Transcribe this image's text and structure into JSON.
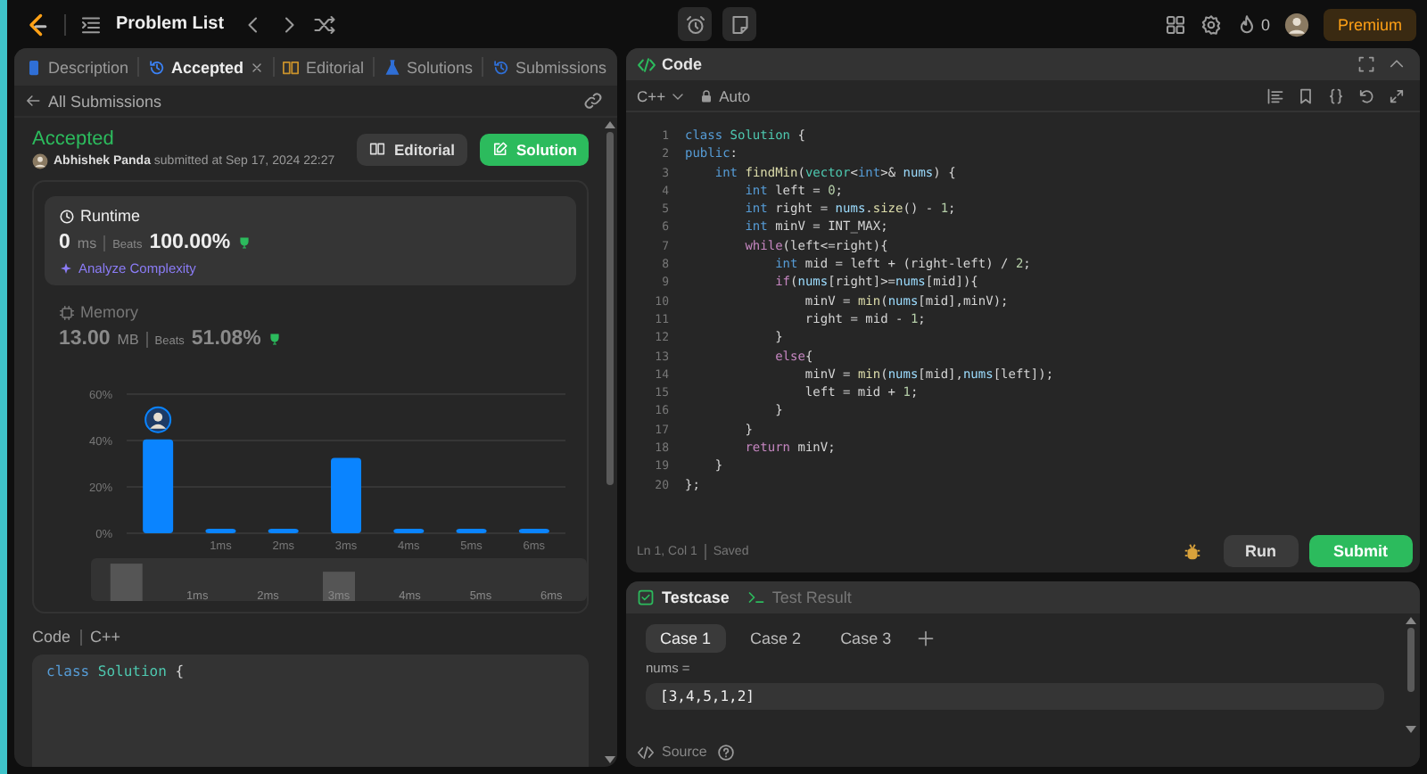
{
  "topbar": {
    "title": "Problem List",
    "fire_count": "0",
    "premium": "Premium"
  },
  "left_panel": {
    "tabs": [
      {
        "label": "Description",
        "selected": false,
        "closable": false
      },
      {
        "label": "Accepted",
        "selected": true,
        "closable": true
      },
      {
        "label": "Editorial",
        "selected": false,
        "closable": false
      },
      {
        "label": "Solutions",
        "selected": false,
        "closable": false
      },
      {
        "label": "Submissions",
        "selected": false,
        "closable": false
      }
    ],
    "back_link": "All Submissions",
    "result": {
      "status": "Accepted",
      "author": "Abhishek Panda",
      "submitted_text": "submitted at Sep 17, 2024 22:27"
    },
    "buttons": [
      {
        "label": "Editorial",
        "kind": "secondary"
      },
      {
        "label": "Solution",
        "kind": "primary"
      }
    ],
    "stats": [
      {
        "title": "Runtime",
        "value": "0",
        "unit": "ms",
        "beats_label": "Beats",
        "beats": "100.00%",
        "selected": true,
        "link": "Analyze Complexity"
      },
      {
        "title": "Memory",
        "value": "13.00",
        "unit": "MB",
        "beats_label": "Beats",
        "beats": "51.08%",
        "selected": false
      }
    ],
    "chart_data": {
      "type": "bar",
      "categories": [
        null,
        "1ms",
        "2ms",
        "3ms",
        "4ms",
        "5ms",
        "6ms"
      ],
      "values": [
        40.5,
        1.2,
        1.2,
        32.5,
        1.8,
        1.2,
        1.2
      ],
      "ylim": [
        0,
        60
      ],
      "yticks": [
        {
          "value": 0,
          "label": "0%"
        },
        {
          "value": 20,
          "label": "20%"
        },
        {
          "value": 40,
          "label": "40%"
        },
        {
          "value": 60,
          "label": "60%"
        }
      ]
    },
    "overview_labels": [
      "1ms",
      "2ms",
      "3ms",
      "4ms",
      "5ms",
      "6ms"
    ],
    "code_label": "Code",
    "code_language": "C++",
    "code_preview": [
      {
        "kind": "kw",
        "text": "class"
      },
      {
        "kind": "type",
        "text": " Solution"
      },
      {
        "kind": "plain",
        "text": " {"
      }
    ]
  },
  "editor": {
    "title": "Code",
    "language": "C++",
    "mode": "Auto",
    "lines": [
      {
        "number": "1",
        "tokens": [
          {
            "kind": "kw",
            "text": "class"
          },
          {
            "kind": "type",
            "text": " Solution"
          },
          {
            "kind": "plain",
            "text": " {"
          }
        ]
      },
      {
        "number": "2",
        "tokens": [
          {
            "kind": "kw",
            "text": "public"
          },
          {
            "kind": "plain",
            "text": ":"
          }
        ]
      },
      {
        "number": "3",
        "tokens": [
          {
            "kind": "kw",
            "text": "    int"
          },
          {
            "kind": "fn",
            "text": " findMin"
          },
          {
            "kind": "plain",
            "text": "("
          },
          {
            "kind": "type",
            "text": "vector"
          },
          {
            "kind": "plain",
            "text": "<"
          },
          {
            "kind": "kw",
            "text": "int"
          },
          {
            "kind": "plain",
            "text": ">& "
          },
          {
            "kind": "var",
            "text": "nums"
          },
          {
            "kind": "plain",
            "text": ") {"
          }
        ]
      },
      {
        "number": "4",
        "tokens": [
          {
            "kind": "kw",
            "text": "        int"
          },
          {
            "kind": "plain",
            "text": " left = "
          },
          {
            "kind": "num",
            "text": "0"
          },
          {
            "kind": "plain",
            "text": ";"
          }
        ]
      },
      {
        "number": "5",
        "tokens": [
          {
            "kind": "kw",
            "text": "        int"
          },
          {
            "kind": "plain",
            "text": " right = "
          },
          {
            "kind": "var",
            "text": "nums"
          },
          {
            "kind": "plain",
            "text": "."
          },
          {
            "kind": "fn",
            "text": "size"
          },
          {
            "kind": "plain",
            "text": "() - "
          },
          {
            "kind": "num",
            "text": "1"
          },
          {
            "kind": "plain",
            "text": ";"
          }
        ]
      },
      {
        "number": "6",
        "tokens": [
          {
            "kind": "kw",
            "text": "        int"
          },
          {
            "kind": "plain",
            "text": " minV = INT_MAX;"
          }
        ]
      },
      {
        "number": "7",
        "tokens": [
          {
            "kind": "ctl",
            "text": "        while"
          },
          {
            "kind": "plain",
            "text": "(left<=right){"
          }
        ]
      },
      {
        "number": "8",
        "tokens": [
          {
            "kind": "kw",
            "text": "            int"
          },
          {
            "kind": "plain",
            "text": " mid = left + (right-left) / "
          },
          {
            "kind": "num",
            "text": "2"
          },
          {
            "kind": "plain",
            "text": ";"
          }
        ]
      },
      {
        "number": "9",
        "tokens": [
          {
            "kind": "ctl",
            "text": "            if"
          },
          {
            "kind": "plain",
            "text": "("
          },
          {
            "kind": "var",
            "text": "nums"
          },
          {
            "kind": "plain",
            "text": "[right]>="
          },
          {
            "kind": "var",
            "text": "nums"
          },
          {
            "kind": "plain",
            "text": "[mid]){"
          }
        ]
      },
      {
        "number": "10",
        "tokens": [
          {
            "kind": "plain",
            "text": "                minV = "
          },
          {
            "kind": "fn",
            "text": "min"
          },
          {
            "kind": "plain",
            "text": "("
          },
          {
            "kind": "var",
            "text": "nums"
          },
          {
            "kind": "plain",
            "text": "[mid],minV);"
          }
        ]
      },
      {
        "number": "11",
        "tokens": [
          {
            "kind": "plain",
            "text": "                right = mid - "
          },
          {
            "kind": "num",
            "text": "1"
          },
          {
            "kind": "plain",
            "text": ";"
          }
        ]
      },
      {
        "number": "12",
        "tokens": [
          {
            "kind": "plain",
            "text": "            }"
          }
        ]
      },
      {
        "number": "13",
        "tokens": [
          {
            "kind": "ctl",
            "text": "            else"
          },
          {
            "kind": "plain",
            "text": "{"
          }
        ]
      },
      {
        "number": "14",
        "tokens": [
          {
            "kind": "plain",
            "text": "                minV = "
          },
          {
            "kind": "fn",
            "text": "min"
          },
          {
            "kind": "plain",
            "text": "("
          },
          {
            "kind": "var",
            "text": "nums"
          },
          {
            "kind": "plain",
            "text": "[mid],"
          },
          {
            "kind": "var",
            "text": "nums"
          },
          {
            "kind": "plain",
            "text": "[left]);"
          }
        ]
      },
      {
        "number": "15",
        "tokens": [
          {
            "kind": "plain",
            "text": "                left = mid + "
          },
          {
            "kind": "num",
            "text": "1"
          },
          {
            "kind": "plain",
            "text": ";"
          }
        ]
      },
      {
        "number": "16",
        "tokens": [
          {
            "kind": "plain",
            "text": "            }"
          }
        ]
      },
      {
        "number": "17",
        "tokens": [
          {
            "kind": "plain",
            "text": "        }"
          }
        ]
      },
      {
        "number": "18",
        "tokens": [
          {
            "kind": "ctl",
            "text": "        return"
          },
          {
            "kind": "plain",
            "text": " minV;"
          }
        ]
      },
      {
        "number": "19",
        "tokens": [
          {
            "kind": "plain",
            "text": "    }"
          }
        ]
      },
      {
        "number": "20",
        "tokens": [
          {
            "kind": "plain",
            "text": "};"
          }
        ]
      }
    ],
    "cursor": "Ln 1, Col 1",
    "save_state": "Saved",
    "buttons": [
      {
        "label": "Run",
        "kind": "secondary"
      },
      {
        "label": "Submit",
        "kind": "primary"
      }
    ]
  },
  "testcase": {
    "tabs": [
      {
        "label": "Testcase",
        "selected": true
      },
      {
        "label": "Test Result",
        "selected": false
      }
    ],
    "cases": [
      {
        "label": "Case 1",
        "selected": true
      },
      {
        "label": "Case 2",
        "selected": false
      },
      {
        "label": "Case 3",
        "selected": false
      }
    ],
    "param_name": "nums =",
    "param_value": "[3,4,5,1,2]",
    "footer": "Source"
  }
}
